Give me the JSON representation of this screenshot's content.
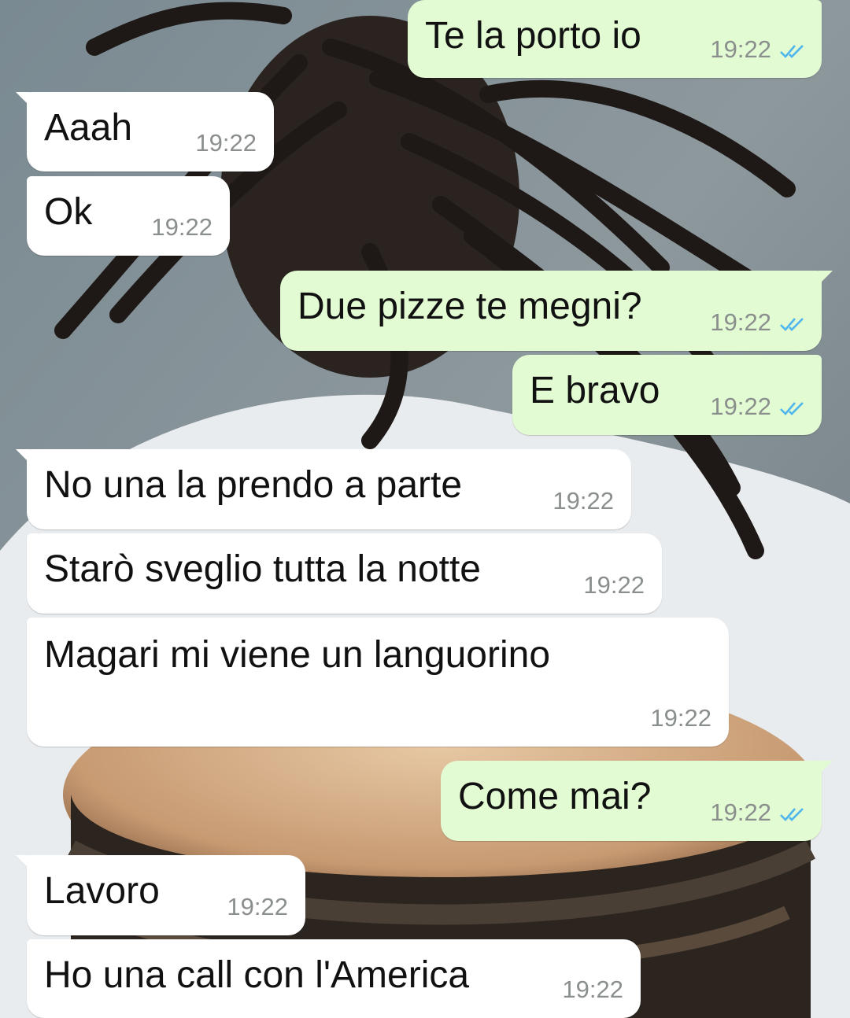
{
  "colors": {
    "incoming_bubble": "#ffffff",
    "outgoing_bubble": "#e2fbd3",
    "timestamp": "#8a8f8d",
    "read_ticks": "#4fb6ec"
  },
  "icons": {
    "read_receipt": "double-check-icon"
  },
  "messages": [
    {
      "direction": "out",
      "text": "Te la porto io",
      "time": "19:22",
      "status": "read"
    },
    {
      "direction": "in",
      "text": "Aaah",
      "time": "19:22"
    },
    {
      "direction": "in",
      "text": "Ok",
      "time": "19:22"
    },
    {
      "direction": "out",
      "text": "Due pizze te megni?",
      "time": "19:22",
      "status": "read"
    },
    {
      "direction": "out",
      "text": "E bravo",
      "time": "19:22",
      "status": "read"
    },
    {
      "direction": "in",
      "text": "No una la prendo a parte",
      "time": "19:22"
    },
    {
      "direction": "in",
      "text": "Starò sveglio tutta la notte",
      "time": "19:22"
    },
    {
      "direction": "in",
      "text": "Magari mi viene un languorino",
      "time": "19:22"
    },
    {
      "direction": "out",
      "text": "Come mai?",
      "time": "19:22",
      "status": "read"
    },
    {
      "direction": "in",
      "text": "Lavoro",
      "time": "19:22"
    },
    {
      "direction": "in",
      "text": "Ho una call con l'America",
      "time": "19:22"
    }
  ]
}
